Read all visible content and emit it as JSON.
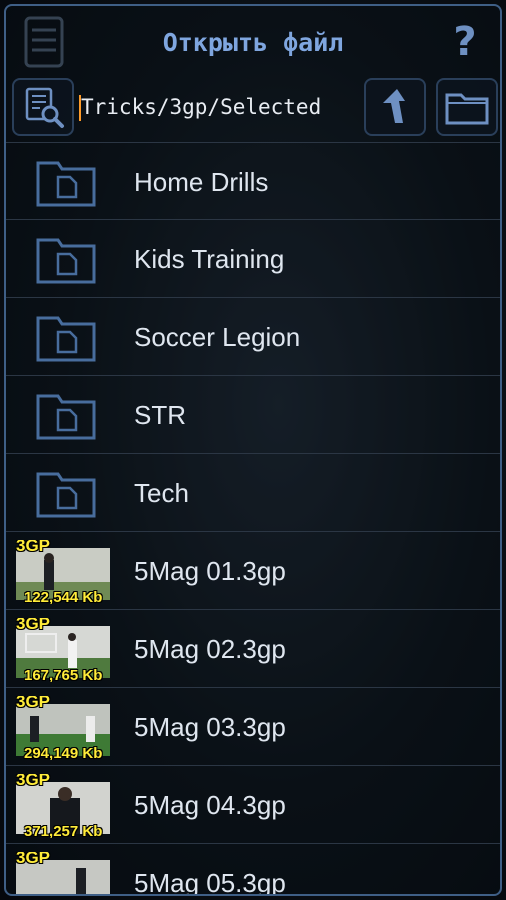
{
  "header": {
    "title": "Открыть файл",
    "menu_icon": "file-list-icon",
    "help_icon": "question-icon",
    "help_glyph": "?"
  },
  "pathbar": {
    "path": "Tricks/3gp/Selected",
    "browse_icon": "search-document-icon",
    "up_icon": "up-arrow-icon",
    "folder_icon": "folder-icon"
  },
  "folders": [
    {
      "label": "Home Drills"
    },
    {
      "label": "Kids Training"
    },
    {
      "label": "Soccer Legion"
    },
    {
      "label": "STR"
    },
    {
      "label": "Tech"
    }
  ],
  "files": [
    {
      "label": "5Mag 01.3gp",
      "badge": "3GP",
      "size": "122,544 Kb"
    },
    {
      "label": "5Mag 02.3gp",
      "badge": "3GP",
      "size": "167,765 Kb"
    },
    {
      "label": "5Mag 03.3gp",
      "badge": "3GP",
      "size": "294,149 Kb"
    },
    {
      "label": "5Mag 04.3gp",
      "badge": "3GP",
      "size": "371,257 Kb"
    },
    {
      "label": "5Mag 05.3gp",
      "badge": "3GP",
      "size": ""
    }
  ],
  "colors": {
    "accent": "#7fa6df",
    "frame": "#3f5f86",
    "badge": "#ffec3a",
    "cursor": "#ff9c2a"
  }
}
